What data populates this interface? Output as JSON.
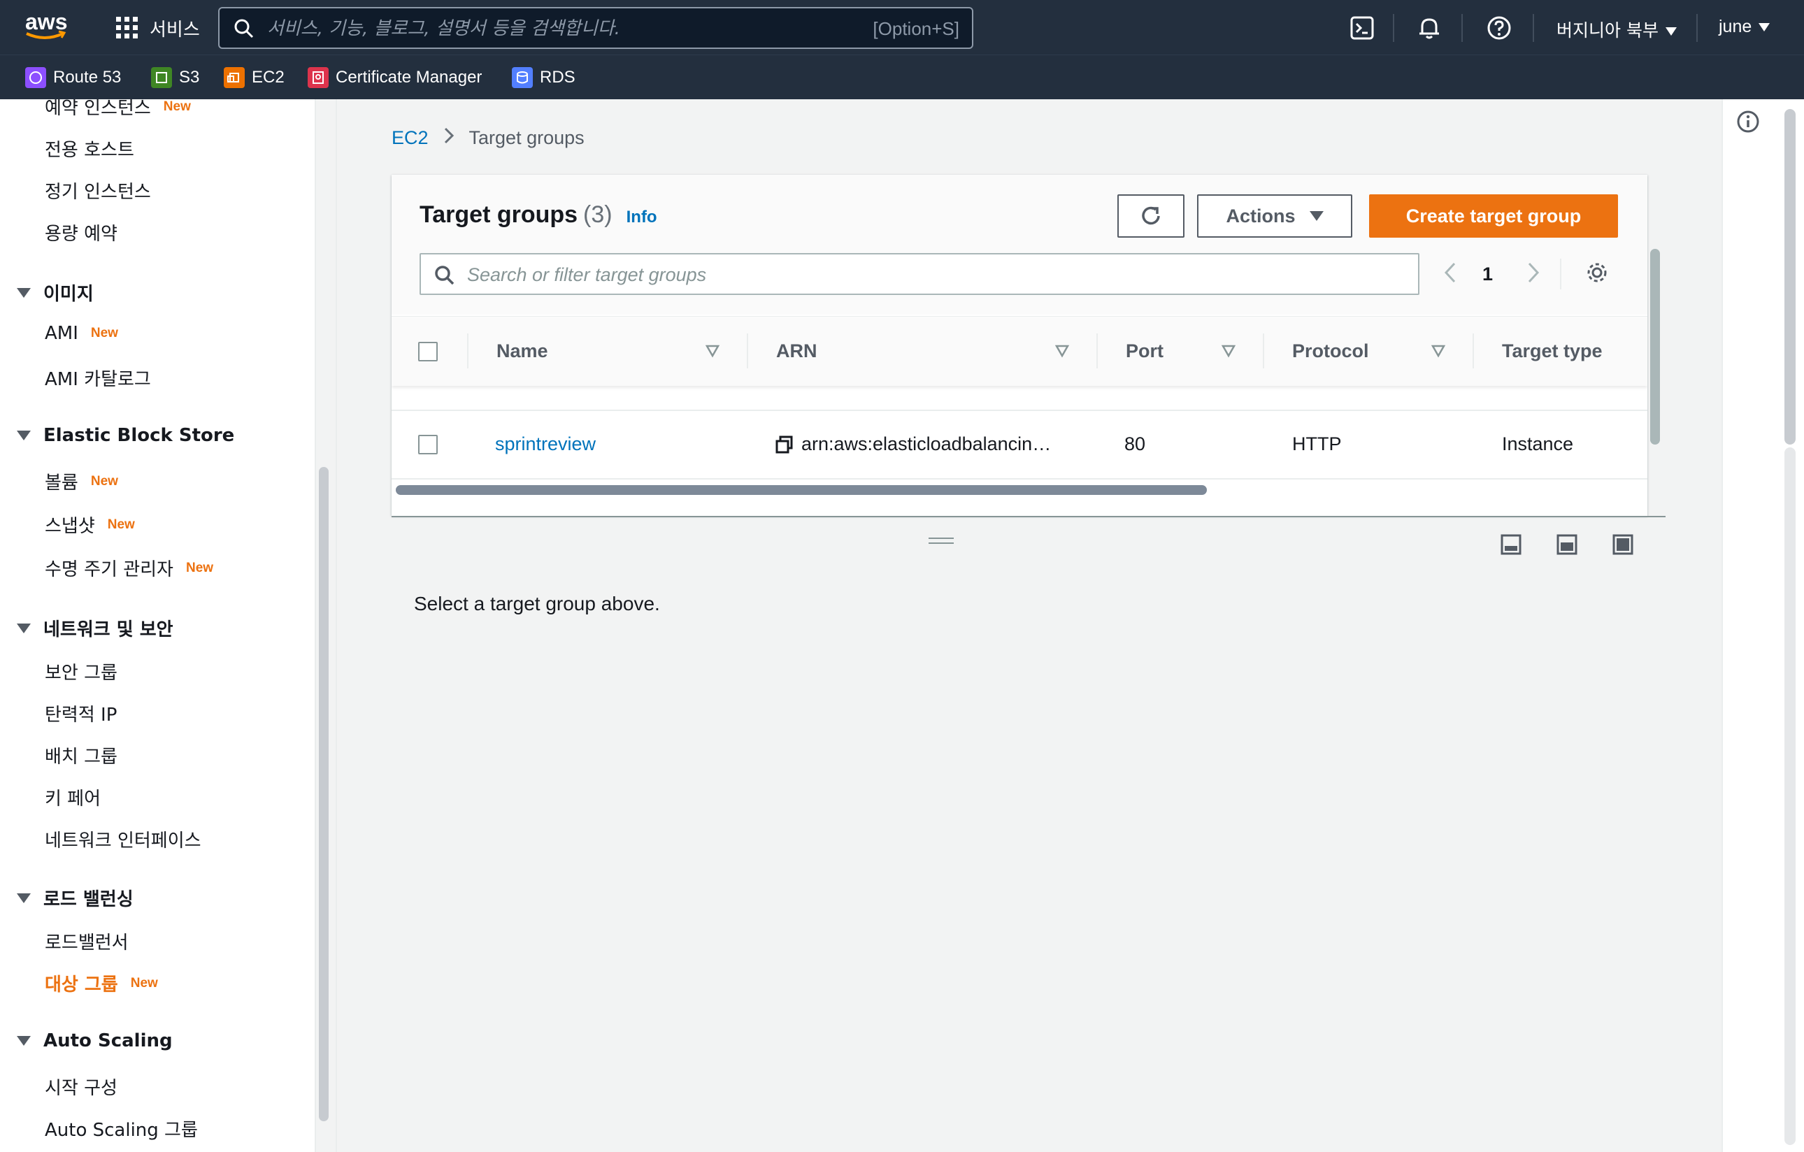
{
  "topnav": {
    "logo_text": "aws",
    "services_label": "서비스",
    "search_placeholder": "서비스, 기능, 블로그, 설명서 등을 검색합니다.",
    "search_shortcut": "[Option+S]",
    "region": "버지니아 북부",
    "user": "june"
  },
  "favorites": [
    {
      "label": "Route 53",
      "color": "#8c4fff"
    },
    {
      "label": "S3",
      "color": "#3f8624"
    },
    {
      "label": "EC2",
      "color": "#ed7100"
    },
    {
      "label": "Certificate Manager",
      "color": "#dd344c"
    },
    {
      "label": "RDS",
      "color": "#527fff"
    }
  ],
  "sidebar": {
    "items_top": [
      {
        "label": "예약 인스턴스",
        "badge": "New"
      },
      {
        "label": "전용 호스트",
        "badge": ""
      },
      {
        "label": "정기 인스턴스",
        "badge": ""
      },
      {
        "label": "용량 예약",
        "badge": ""
      }
    ],
    "section_images": "이미지",
    "images_items": [
      {
        "label": "AMI",
        "badge": "New"
      },
      {
        "label": "AMI 카탈로그",
        "badge": ""
      }
    ],
    "section_ebs": "Elastic Block Store",
    "ebs_items": [
      {
        "label": "볼륨",
        "badge": "New"
      },
      {
        "label": "스냅샷",
        "badge": "New"
      },
      {
        "label": "수명 주기 관리자",
        "badge": "New"
      }
    ],
    "section_network": "네트워크 및 보안",
    "network_items": [
      {
        "label": "보안 그룹"
      },
      {
        "label": "탄력적 IP"
      },
      {
        "label": "배치 그룹"
      },
      {
        "label": "키 페어"
      },
      {
        "label": "네트워크 인터페이스"
      }
    ],
    "section_lb": "로드 밸런싱",
    "lb_items": [
      {
        "label": "로드밸런서",
        "badge": ""
      },
      {
        "label": "대상 그룹",
        "badge": "New"
      }
    ],
    "section_asg": "Auto Scaling",
    "asg_items": [
      {
        "label": "시작 구성"
      },
      {
        "label": "Auto Scaling 그룹"
      }
    ]
  },
  "breadcrumb": {
    "root": "EC2",
    "current": "Target groups"
  },
  "panel": {
    "title": "Target groups",
    "count": "(3)",
    "info": "Info",
    "actions_label": "Actions",
    "create_label": "Create target group",
    "filter_placeholder": "Search or filter target groups",
    "page": "1"
  },
  "table": {
    "columns": [
      "Name",
      "ARN",
      "Port",
      "Protocol",
      "Target type"
    ],
    "rows": [
      {
        "name": "sprintreview",
        "arn": "arn:aws:elasticloadbalancin…",
        "port": "80",
        "protocol": "HTTP",
        "target_type": "Instance"
      }
    ]
  },
  "details": {
    "empty_message": "Select a target group above."
  },
  "colors": {
    "accent": "#ec7211",
    "link": "#0073bb",
    "nav_bg": "#232f3e"
  }
}
